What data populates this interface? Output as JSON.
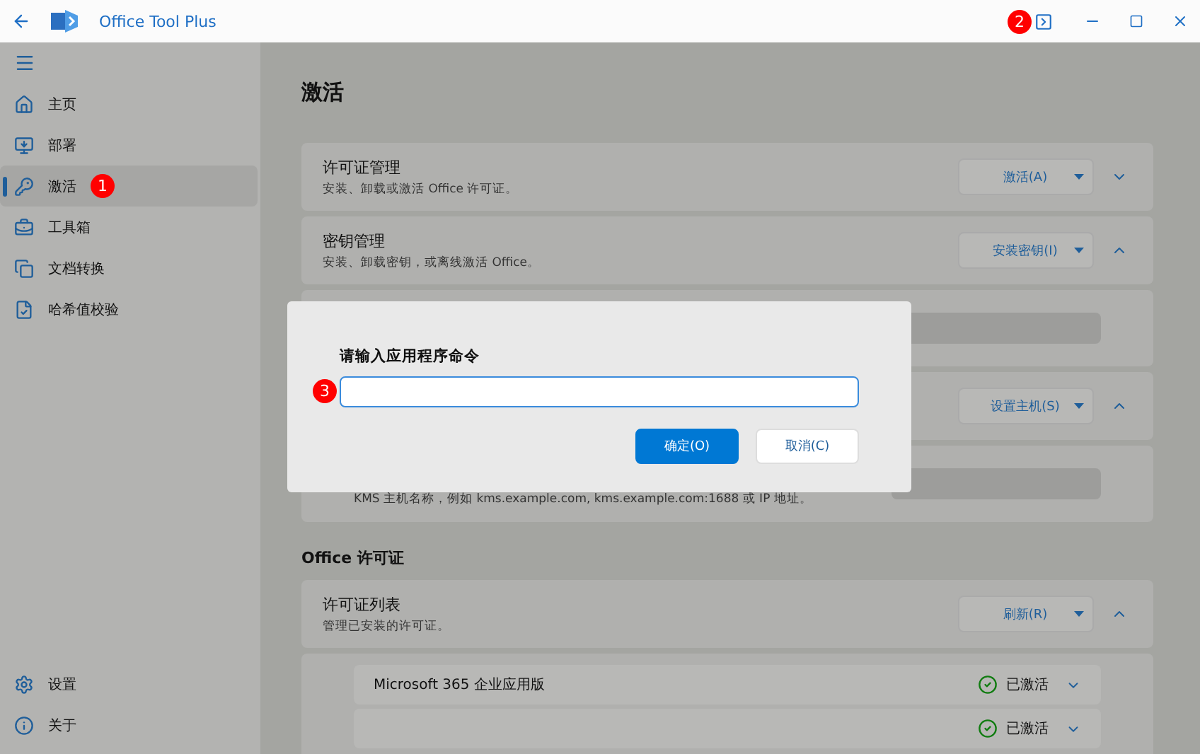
{
  "window": {
    "title": "Office Tool Plus",
    "badge": "2"
  },
  "sidebar": {
    "items": [
      {
        "label": "主页",
        "selected": false
      },
      {
        "label": "部署",
        "selected": false
      },
      {
        "label": "激活",
        "selected": true,
        "badge": "1"
      },
      {
        "label": "工具箱",
        "selected": false
      },
      {
        "label": "文档转换",
        "selected": false
      },
      {
        "label": "哈希值校验",
        "selected": false
      }
    ],
    "footer": [
      {
        "label": "设置"
      },
      {
        "label": "关于"
      }
    ]
  },
  "page": {
    "title": "激活",
    "blocks": [
      {
        "kind": "card",
        "title": "许可证管理",
        "description": "安装、卸载或激活 Office 许可证。",
        "button": "激活(A)",
        "expanded": false
      },
      {
        "kind": "card",
        "title": "密钥管理",
        "description": "安装、卸载密钥，或离线激活 Office。",
        "button": "安装密钥(I)",
        "expanded": true
      },
      {
        "kind": "panel"
      },
      {
        "kind": "card",
        "button": "设置主机(S)",
        "expanded": true
      },
      {
        "kind": "panel",
        "description": "KMS 主机名称，例如 kms.example.com, kms.example.com:1688 或 IP 地址。"
      },
      {
        "kind": "heading",
        "title": "Office 许可证"
      },
      {
        "kind": "card",
        "title": "许可证列表",
        "description": "管理已安装的许可证。",
        "button": "刷新(R)",
        "expanded": true
      },
      {
        "kind": "licenses",
        "rows": [
          {
            "name": "Microsoft 365 企业应用版",
            "status": "已激活"
          },
          {
            "status": "已激活"
          }
        ]
      }
    ]
  },
  "dialog": {
    "title": "请输入应用程序命令",
    "badge": "3",
    "buttons": [
      {
        "label": "确定(O)",
        "primary": true
      },
      {
        "label": "取消(C)",
        "primary": false
      }
    ]
  }
}
